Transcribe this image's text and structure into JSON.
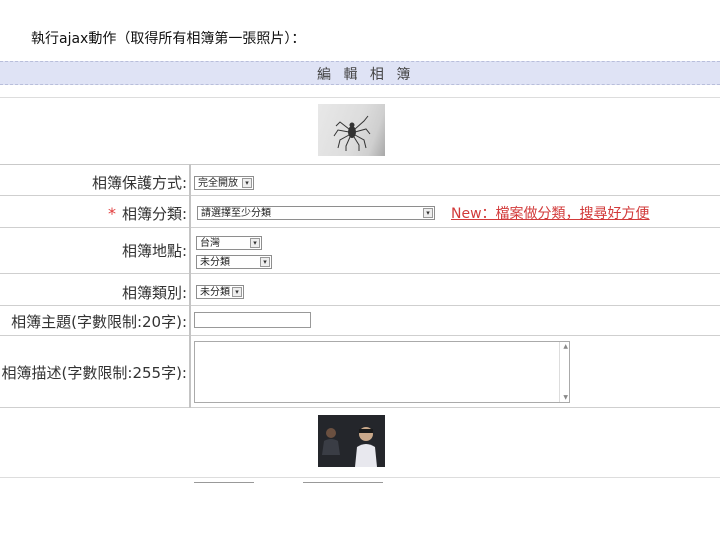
{
  "caption": "執行ajax動作（取得所有相簿第一張照片）：",
  "panel": {
    "title": "編 輯 相 簿"
  },
  "form": {
    "privacy": {
      "label": "相簿保護方式:",
      "value": "完全開放"
    },
    "category": {
      "required_mark": "*",
      "label": "相簿分類:",
      "value": "請選擇至少分類",
      "note": "New：檔案做分類，搜尋好方便"
    },
    "location": {
      "label": "相簿地點:",
      "value1": "台灣",
      "value2": "未分類"
    },
    "type": {
      "label": "相簿類別:",
      "value": "未分類"
    },
    "album_title": {
      "label": "相簿主題(字數限制:20字):",
      "value": ""
    },
    "album_desc": {
      "label": "相簿描述(字數限制:255字):",
      "value": ""
    }
  },
  "icons": {
    "dropdown": "▾",
    "scroll_up": "▲",
    "scroll_down": "▼"
  },
  "colors": {
    "panel_bg": "#dfe3f5",
    "required": "#e23b3b",
    "note": "#d23a3a"
  }
}
